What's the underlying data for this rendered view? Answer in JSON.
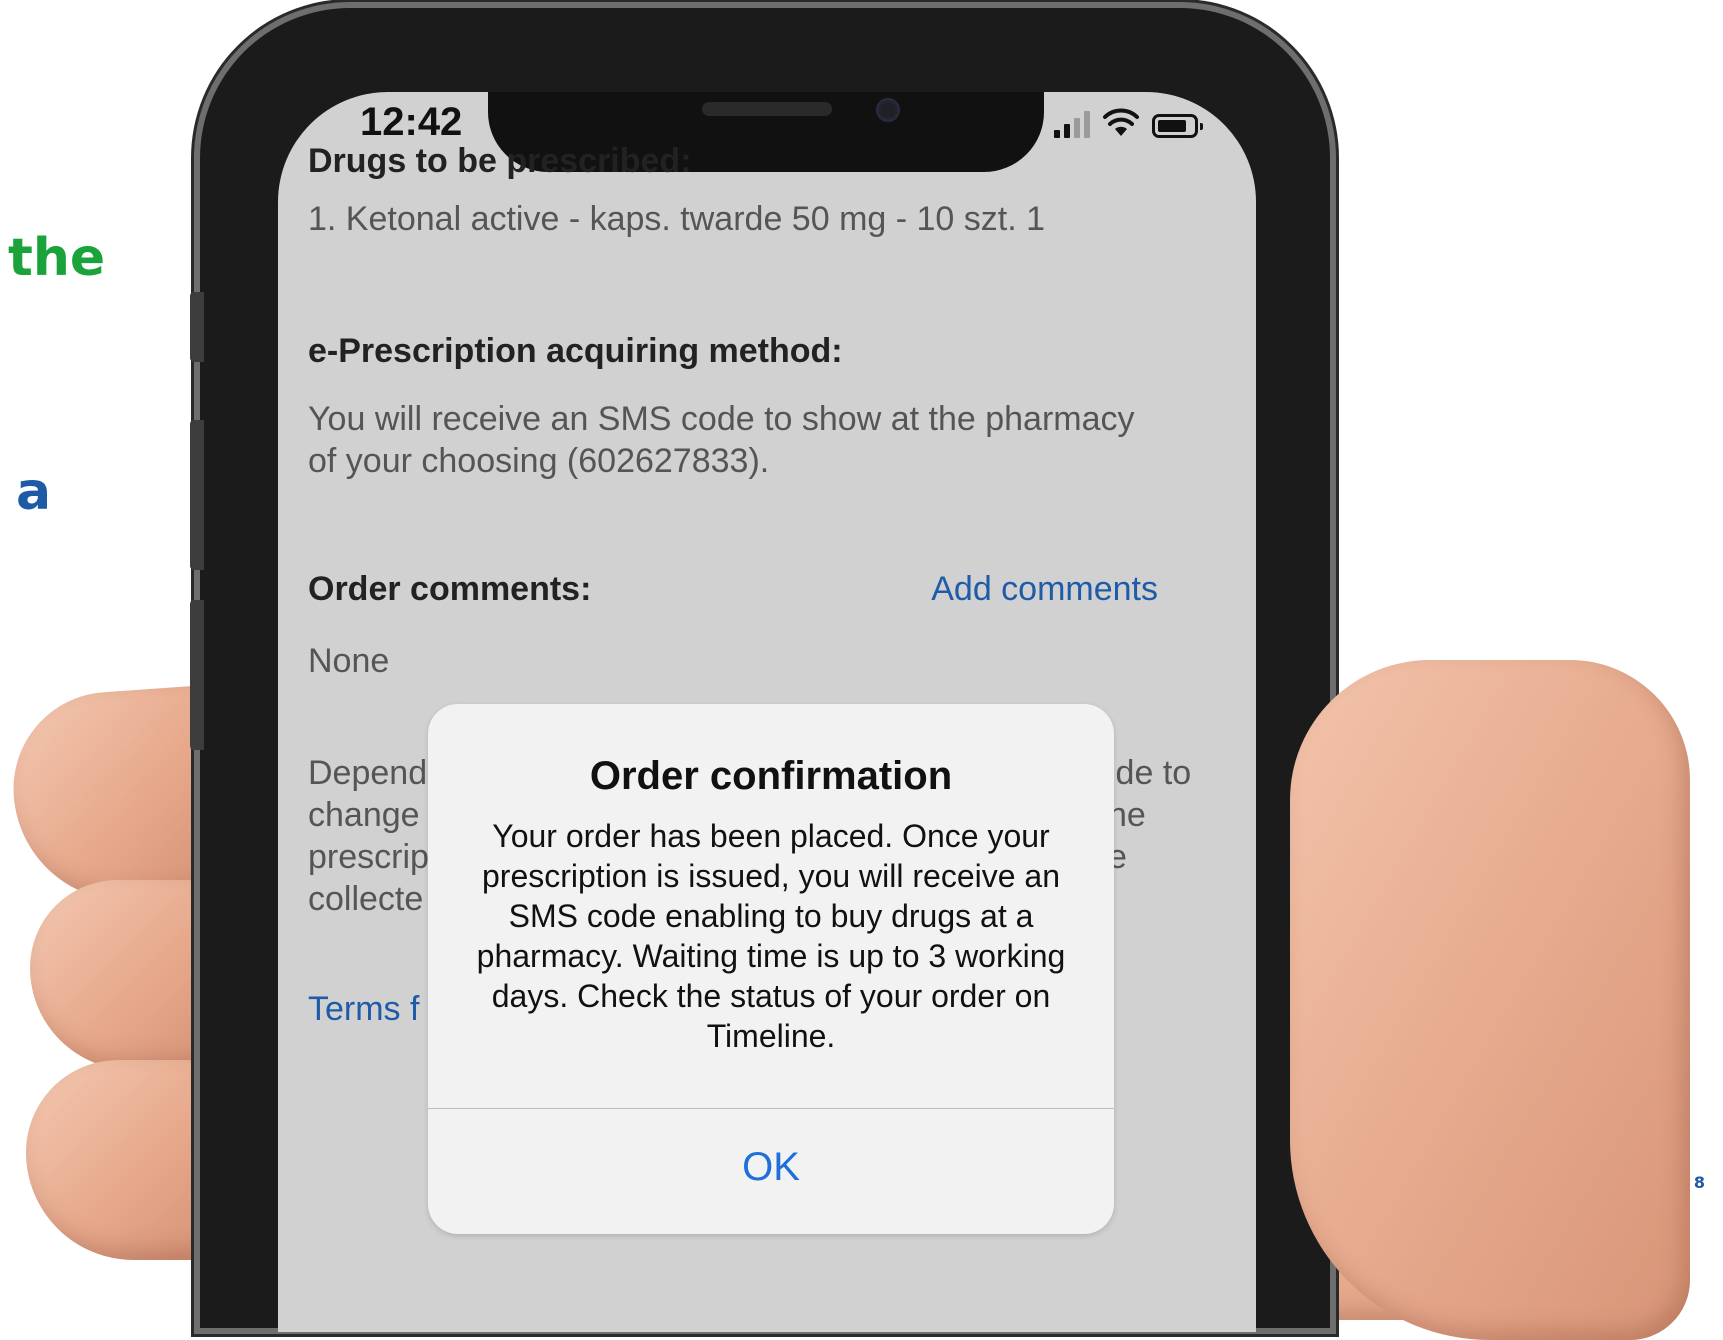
{
  "slide": {
    "fragment_green": "the",
    "fragment_blue": "a",
    "page_number": "8"
  },
  "status_bar": {
    "time": "12:42",
    "icons": [
      "signal-icon",
      "wifi-icon",
      "battery-icon"
    ]
  },
  "order": {
    "drugs_heading": "Drugs to be prescribed:",
    "drug_item": "1.   Ketonal active - kaps. twarde 50 mg - 10 szt. 1",
    "method_heading": "e-Prescription acquiring method:",
    "method_text": "You will receive an SMS code to show at the pharmacy of your choosing (602627833).",
    "comments_heading": "Order comments:",
    "add_comments_link": "Add comments",
    "comments_value": "None",
    "partial_left_lines": [
      "Depend",
      "change",
      "prescrip",
      "collecte"
    ],
    "partial_right_lines": [
      "ide to",
      "he",
      "e"
    ],
    "terms_partial": "Terms f"
  },
  "alert": {
    "title": "Order confirmation",
    "message": "Your order has been placed. Once your prescription is issued, you will receive an SMS code enabling to buy drugs at a pharmacy. Waiting time is up to 3 working days. Check the status of your order on Timeline.",
    "button_label": "OK"
  },
  "colors": {
    "slide_green": "#1aa33a",
    "slide_blue": "#1f5aa6",
    "link_blue": "#1e5ba8",
    "alert_button": "#1e6fd9",
    "screen_bg": "#d1d1d1",
    "alert_bg": "#f2f2f2"
  }
}
